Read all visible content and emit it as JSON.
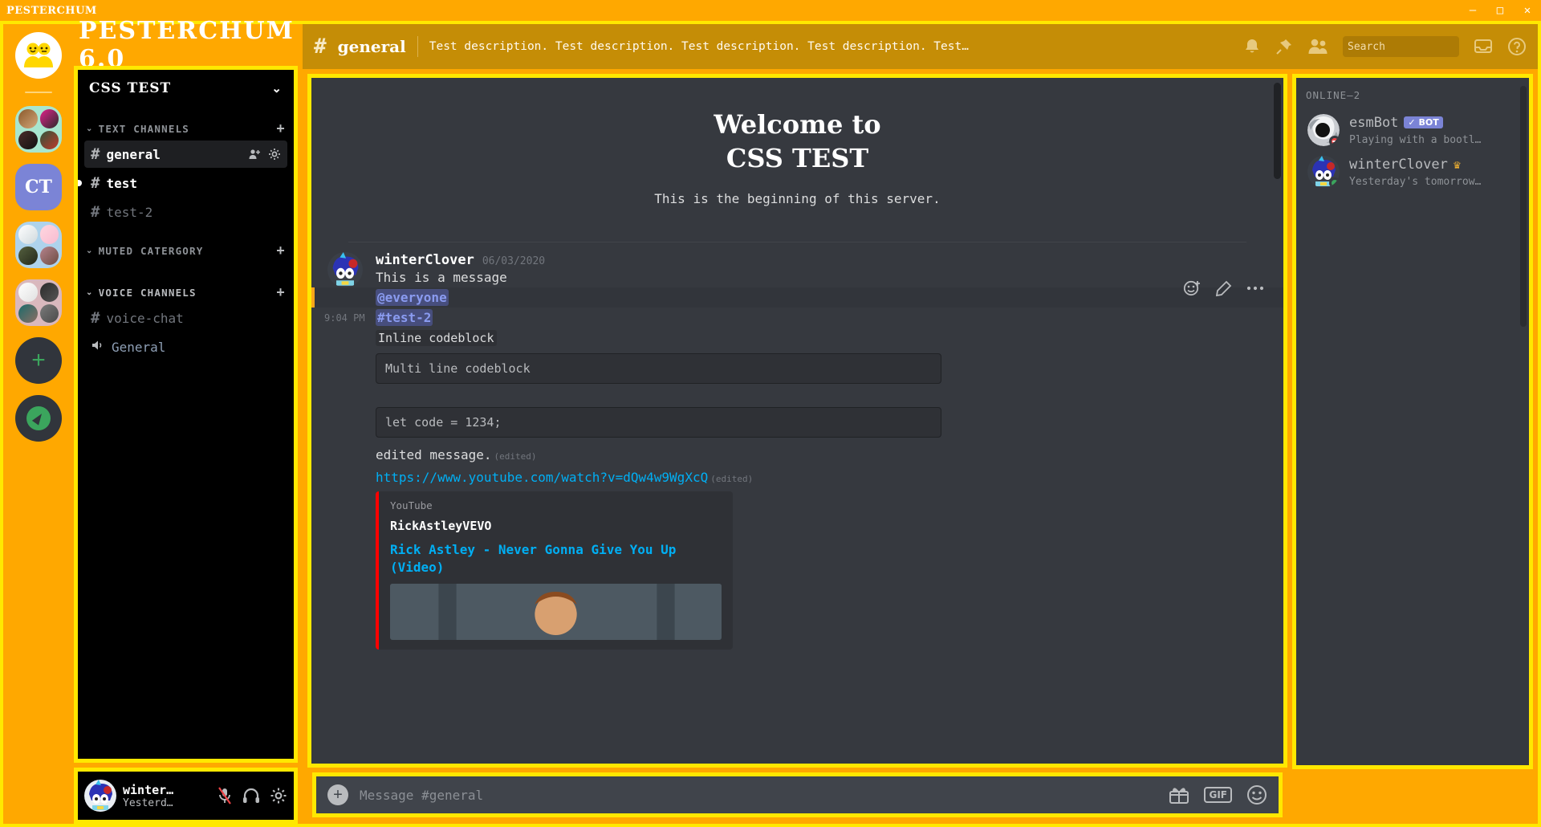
{
  "window": {
    "title": "PESTERCHUM",
    "minimize": "–",
    "maximize": "□",
    "close": "✕"
  },
  "brand": {
    "title": "PESTERCHUM 6.0"
  },
  "server_rail": {
    "items": [
      {
        "name": "home-server",
        "label": "",
        "type": "home"
      },
      {
        "name": "server-folder-1",
        "label": "",
        "type": "folder"
      },
      {
        "name": "server-ct",
        "label": "CT",
        "type": "text"
      },
      {
        "name": "server-folder-2",
        "label": "",
        "type": "folder"
      },
      {
        "name": "server-folder-3",
        "label": "",
        "type": "folder"
      },
      {
        "name": "add-server",
        "label": "+",
        "type": "add"
      },
      {
        "name": "explore-servers",
        "label": "",
        "type": "explore"
      }
    ]
  },
  "sidebar": {
    "guild_name": "CSS TEST",
    "guild_chevron": "⌄",
    "categories": [
      {
        "label": "TEXT CHANNELS",
        "caret": "⌄",
        "add": "+",
        "channels": [
          {
            "name": "general",
            "icon": "hash",
            "state": "active"
          },
          {
            "name": "test",
            "icon": "hash",
            "state": "unread"
          },
          {
            "name": "test-2",
            "icon": "hash",
            "state": "normal"
          }
        ]
      },
      {
        "label": "MUTED CATERGORY",
        "caret": "⌄",
        "add": "+",
        "channels": []
      },
      {
        "label": "VOICE CHANNELS",
        "caret": "⌄",
        "add": "+",
        "channels": [
          {
            "name": "voice-chat",
            "icon": "hash",
            "state": "normal"
          },
          {
            "name": "General",
            "icon": "speaker",
            "state": "normal"
          }
        ]
      }
    ]
  },
  "user_panel": {
    "name": "winter…",
    "status": "Yesterd…",
    "mic_icon": "mic-muted-icon",
    "headphone_icon": "headphones-icon",
    "settings_icon": "gear-icon"
  },
  "channel_header": {
    "hash": "#",
    "channel": "general",
    "topic": "Test description. Test description. Test description. Test description. Test descr…",
    "icons": [
      "bell-icon",
      "pin-icon",
      "members-icon",
      "inbox-icon",
      "help-icon"
    ],
    "search": {
      "placeholder": "Search",
      "value": ""
    }
  },
  "welcome": {
    "line1": "Welcome to",
    "line2": "CSS TEST",
    "subtitle": "This is the beginning of this server."
  },
  "messages": {
    "author": "winterClover",
    "date": "06/03/2020",
    "first_text": "This is a message",
    "mention_row": {
      "mention": "@everyone"
    },
    "channel_row": {
      "time": "9:04 PM",
      "channel_link": "#test-2"
    },
    "inline_code": "Inline codeblock",
    "block_code_1": "Multi line codeblock",
    "block_code_2": "let code = 1234;",
    "edited_text": "edited message.",
    "edited_tag": "(edited)",
    "link_url": "https://www.youtube.com/watch?v=dQw4w9WgXcQ",
    "link_edited_tag": "(edited)",
    "hover_actions": [
      "add-reaction-icon",
      "edit-icon",
      "more-options-icon"
    ],
    "embed": {
      "provider": "YouTube",
      "author": "RickAstleyVEVO",
      "title": "Rick Astley - Never Gonna Give You Up (Video)",
      "accent_color": "#ff0000"
    }
  },
  "composer": {
    "placeholder": "Message #general",
    "value": "",
    "plus": "+",
    "gift_icon": "gift-icon",
    "gif_label": "GIF",
    "emoji_icon": "emoji-icon"
  },
  "members": {
    "title": "ONLINE—2",
    "list": [
      {
        "name": "esmBot",
        "badge": "✓ BOT",
        "status_text": "Playing with a bootl…",
        "presence": "dnd",
        "presence_color": "#ed4245",
        "crown": ""
      },
      {
        "name": "winterClover",
        "badge": "",
        "status_text": "Yesterday's tomorrow…",
        "presence": "online",
        "presence_color": "#3ba55d",
        "crown": "♛"
      }
    ]
  },
  "theme": {
    "frame_yellow": "#FFE800",
    "background_orange": "#FFA800",
    "header_gold": "#C58D06",
    "panel_dark": "#36393f",
    "panel_black": "#000000",
    "accent_blurple": "#7b84d6"
  }
}
